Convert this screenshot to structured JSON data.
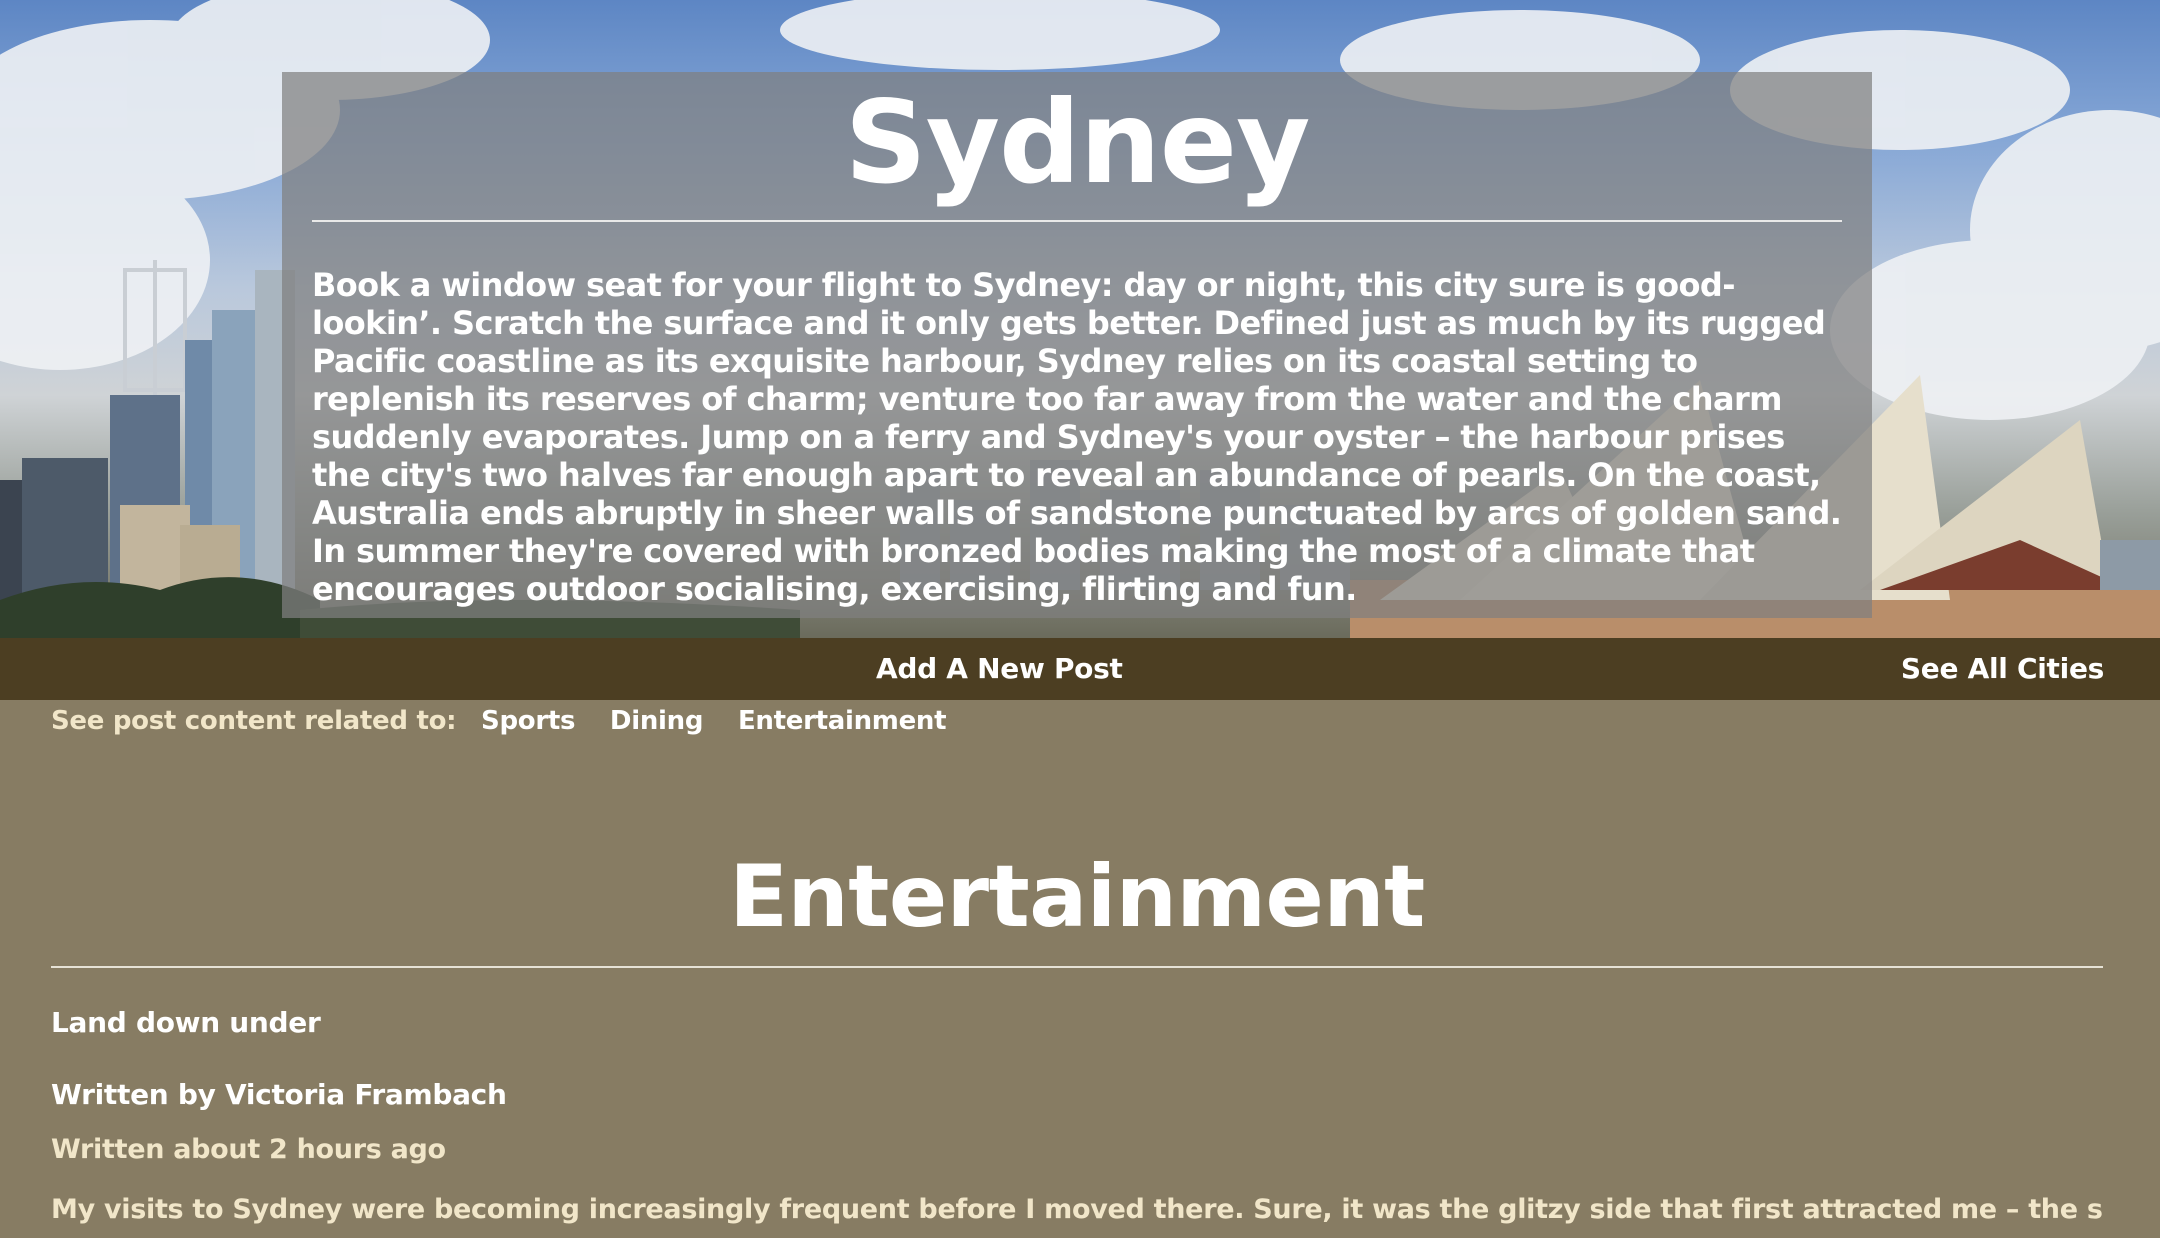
{
  "hero": {
    "city_name": "Sydney",
    "description": "Book a window seat for your flight to Sydney: day or night, this city sure is good-lookin’. Scratch the surface and it only gets better. Defined just as much by its rugged Pacific coastline as its exquisite harbour, Sydney relies on its coastal setting to replenish its reserves of charm; venture too far away from the water and the charm suddenly evaporates. Jump on a ferry and Sydney's your oyster – the harbour prises the city's two halves far enough apart to reveal an abundance of pearls. On the coast, Australia ends abruptly in sheer walls of sandstone punctuated by arcs of golden sand. In summer they're covered with bronzed bodies making the most of a climate that encourages outdoor socialising, exercising, flirting and fun."
  },
  "nav": {
    "add_post": "Add A New Post",
    "see_all_cities": "See All Cities"
  },
  "filters": {
    "label": "See post content related to:",
    "items": [
      "Sports",
      "Dining",
      "Entertainment"
    ]
  },
  "section": {
    "title": "Entertainment",
    "post": {
      "title": "Land down under",
      "author": "Written by Victoria Frambach",
      "time": "Written about 2 hours ago",
      "body": "My visits to Sydney were becoming increasingly frequent before I moved there. Sure, it was the glitzy side that first attracted me – the sense that there was"
    }
  },
  "colors": {
    "page_bg": "#877c63",
    "navbar_bg": "#4c3e22",
    "muted_text": "#f1e6c9",
    "card_bg": "rgba(128,128,128,0.72)"
  }
}
